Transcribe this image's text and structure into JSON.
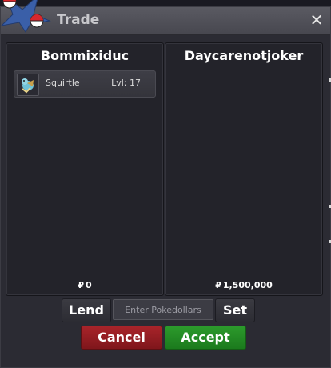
{
  "window": {
    "title": "Trade",
    "close_glyph": "✕"
  },
  "left_panel": {
    "player_name": "Bommixiduc",
    "items": [
      {
        "icon": "squirtle-sprite-icon",
        "name": "Squirtle",
        "level": "Lvl: 17"
      }
    ],
    "currency_symbol": "₽",
    "money": "0"
  },
  "right_panel": {
    "player_name": "Daycarenotjoker",
    "items": [],
    "currency_symbol": "₽",
    "money": "1,500,000"
  },
  "controls": {
    "lend_label": "Lend",
    "pokedollars_placeholder": "Enter Pokedollars",
    "set_label": "Set",
    "cancel_label": "Cancel",
    "accept_label": "Accept"
  },
  "colors": {
    "cancel": "#a8242a",
    "accept": "#2c9a2c",
    "panel": "#23232a",
    "titlebar": "#4f4f57"
  },
  "icons": {
    "logo": "pokeball-logo-icon",
    "close": "close-icon"
  }
}
